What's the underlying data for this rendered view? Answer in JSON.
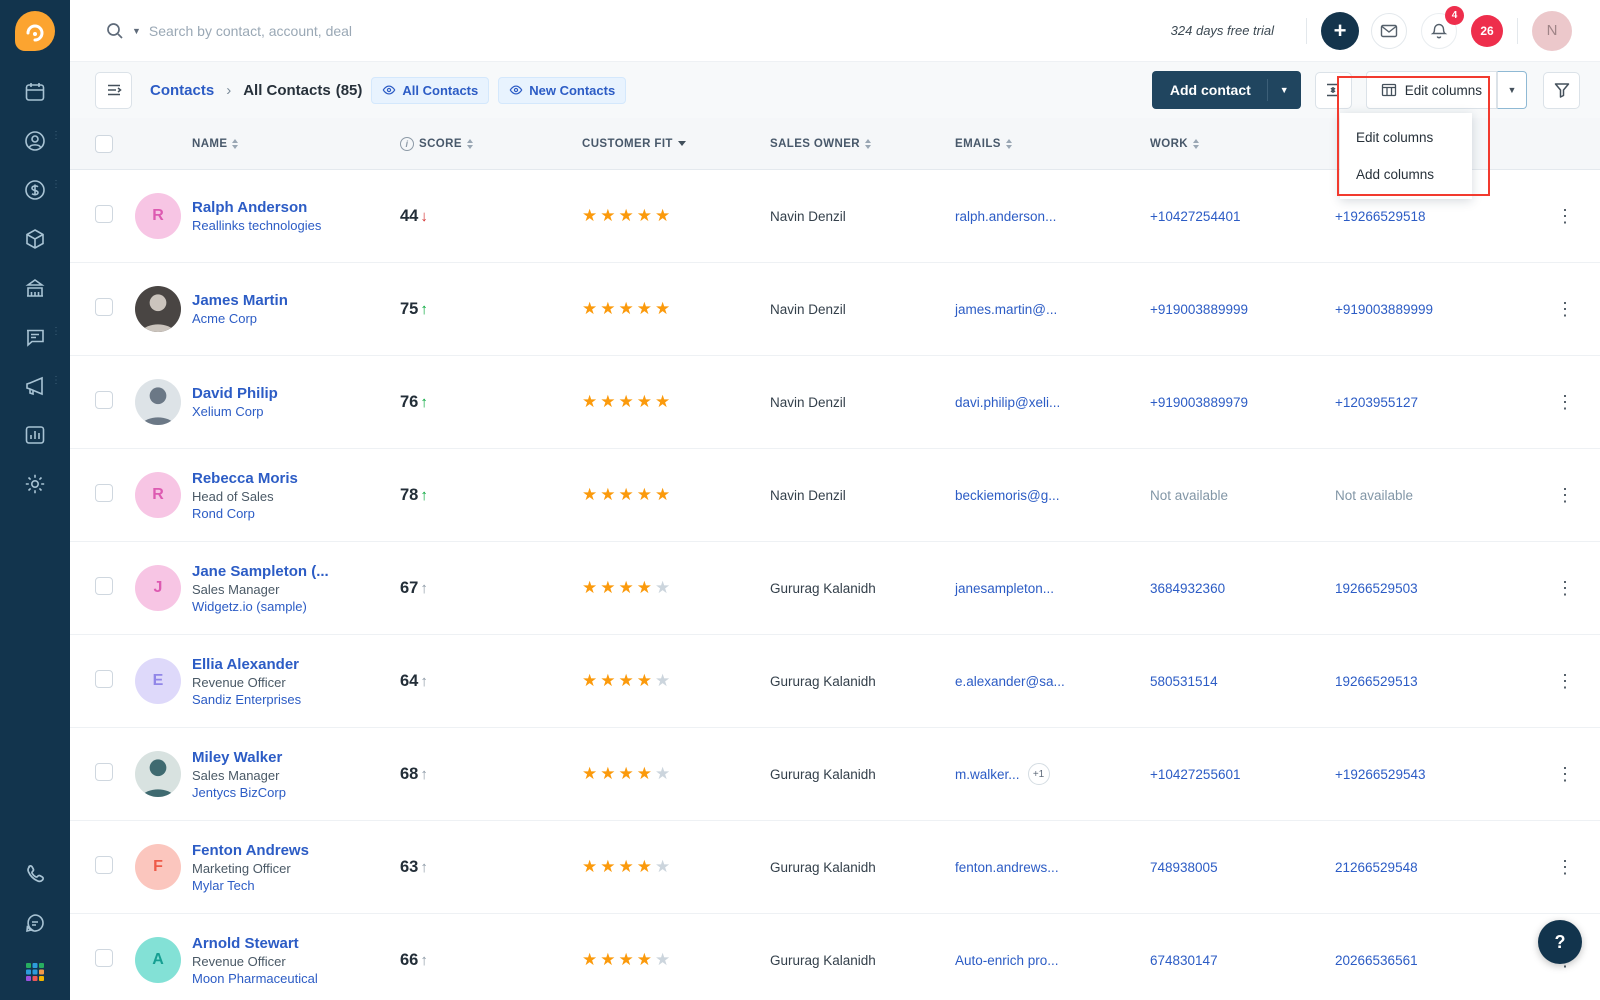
{
  "topbar": {
    "search_placeholder": "Search by contact, account, deal",
    "trial_text": "324 days free trial",
    "notif_badge": "4",
    "notif_count": "26",
    "avatar_initial": "N",
    "plus_label": "+"
  },
  "toolbar": {
    "breadcrumb_root": "Contacts",
    "breadcrumb_current": "All Contacts",
    "breadcrumb_count": "(85)",
    "chips": [
      {
        "label": "All Contacts"
      },
      {
        "label": "New Contacts"
      }
    ],
    "add_contact_label": "Add contact",
    "edit_columns_label": "Edit columns",
    "dropdown_items": [
      "Edit columns",
      "Add columns"
    ]
  },
  "table": {
    "headers": [
      "NAME",
      "SCORE",
      "CUSTOMER FIT",
      "SALES OWNER",
      "EMAILS",
      "WORK"
    ],
    "not_available": "Not available",
    "rows": [
      {
        "name": "Ralph Anderson",
        "title": "",
        "company": "Reallinks technologies",
        "avatar": {
          "kind": "initial",
          "text": "R",
          "bg": "#f7c5e4",
          "fg": "#dd5ab1"
        },
        "score": "44",
        "trend": "down",
        "stars": 5,
        "owner": "Navin Denzil",
        "email": "ralph.anderson...",
        "email_badge": "",
        "work": "+10427254401",
        "mobile": "+19266529518"
      },
      {
        "name": "James Martin",
        "title": "",
        "company": "Acme Corp",
        "avatar": {
          "kind": "photo",
          "bg": "#494543",
          "fg": "#cbc4bd"
        },
        "score": "75",
        "trend": "up",
        "stars": 5,
        "owner": "Navin Denzil",
        "email": "james.martin@...",
        "email_badge": "",
        "work": "+919003889999",
        "mobile": "+919003889999"
      },
      {
        "name": "David Philip",
        "title": "",
        "company": "Xelium Corp",
        "avatar": {
          "kind": "photo",
          "bg": "#dde3e7",
          "fg": "#6b7886"
        },
        "score": "76",
        "trend": "up",
        "stars": 5,
        "owner": "Navin Denzil",
        "email": "davi.philip@xeli...",
        "email_badge": "",
        "work": "+919003889979",
        "mobile": "+1203955127"
      },
      {
        "name": "Rebecca Moris",
        "title": "Head of Sales",
        "company": "Rond Corp",
        "avatar": {
          "kind": "initial",
          "text": "R",
          "bg": "#f7c5e4",
          "fg": "#dd5ab1"
        },
        "score": "78",
        "trend": "up",
        "stars": 5,
        "owner": "Navin Denzil",
        "email": "beckiemoris@g...",
        "email_badge": "",
        "work": "Not available",
        "mobile": "Not available"
      },
      {
        "name": "Jane Sampleton (...",
        "title": "Sales Manager",
        "company": "Widgetz.io (sample)",
        "avatar": {
          "kind": "initial",
          "text": "J",
          "bg": "#f7c5e4",
          "fg": "#dd5ab1"
        },
        "score": "67",
        "trend": "up-gray",
        "stars": 4,
        "owner": "Gururag Kalanidh",
        "email": "janesampleton...",
        "email_badge": "",
        "work": "3684932360",
        "mobile": "19266529503"
      },
      {
        "name": "Ellia Alexander",
        "title": "Revenue Officer",
        "company": "Sandiz Enterprises",
        "avatar": {
          "kind": "initial",
          "text": "E",
          "bg": "#ded9fa",
          "fg": "#9186e8"
        },
        "score": "64",
        "trend": "up-gray",
        "stars": 4,
        "owner": "Gururag Kalanidh",
        "email": "e.alexander@sa...",
        "email_badge": "",
        "work": "580531514",
        "mobile": "19266529513"
      },
      {
        "name": "Miley Walker",
        "title": "Sales Manager",
        "company": "Jentycs BizCorp",
        "avatar": {
          "kind": "photo",
          "bg": "#d8e2e0",
          "fg": "#3f6a70"
        },
        "score": "68",
        "trend": "up-gray",
        "stars": 4,
        "owner": "Gururag Kalanidh",
        "email": "m.walker...",
        "email_badge": "+1",
        "work": "+10427255601",
        "mobile": "+19266529543"
      },
      {
        "name": "Fenton Andrews",
        "title": "Marketing Officer",
        "company": "Mylar Tech",
        "avatar": {
          "kind": "initial",
          "text": "F",
          "bg": "#fbc6be",
          "fg": "#ee5a49"
        },
        "score": "63",
        "trend": "up-gray",
        "stars": 4,
        "owner": "Gururag Kalanidh",
        "email": "fenton.andrews...",
        "email_badge": "",
        "work": "748938005",
        "mobile": "21266529548"
      },
      {
        "name": "Arnold Stewart",
        "title": "Revenue Officer",
        "company": "Moon Pharmaceutical",
        "avatar": {
          "kind": "initial",
          "text": "A",
          "bg": "#83e1d6",
          "fg": "#169f92"
        },
        "score": "66",
        "trend": "up-gray",
        "stars": 4,
        "owner": "Gururag Kalanidh",
        "email": "Auto-enrich pro...",
        "email_badge": "",
        "work": "674830147",
        "mobile": "20266536561"
      }
    ]
  },
  "help": {
    "label": "?"
  },
  "colors": {
    "sidebar": "#12344d",
    "accent_blue": "#2c5cc5",
    "star_orange": "#fb9a0c",
    "annotation_red": "#f23a2e",
    "badge_red": "#ee2e4c",
    "navy_button": "#20455f"
  }
}
